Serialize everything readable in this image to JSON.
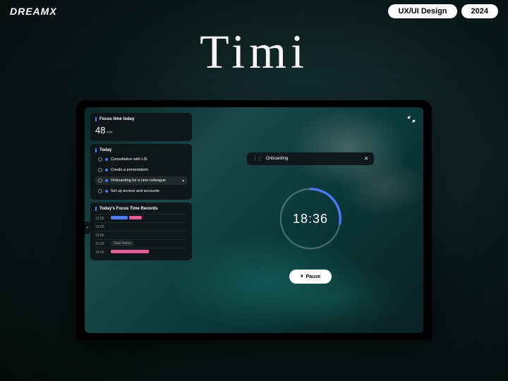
{
  "header": {
    "logo": "DREAMX",
    "pill1": "UX/UI Design",
    "pill2": "2024"
  },
  "product_title": "Timi",
  "focus_card": {
    "title": "Focus time today",
    "value": "48",
    "unit": "min"
  },
  "today": {
    "title": "Today",
    "tasks": [
      {
        "name": "Consultation with LIS"
      },
      {
        "name": "Create a presentation"
      },
      {
        "name": "Onboarding for a new colleague"
      },
      {
        "name": "Set up access and accounts"
      }
    ]
  },
  "records": {
    "title": "Today's Focus Time Records",
    "rows": [
      "12:00",
      "13:00",
      "14:00",
      "15:00",
      "16:00"
    ],
    "tag": "Task Name"
  },
  "timer": {
    "task_label": "Onboarding",
    "time": "18:36",
    "pause_label": "Pause"
  },
  "colors": {
    "accent_blue": "#4a7aff",
    "accent_pink": "#e85a9a",
    "accent_teal": "#2dd4c4"
  }
}
